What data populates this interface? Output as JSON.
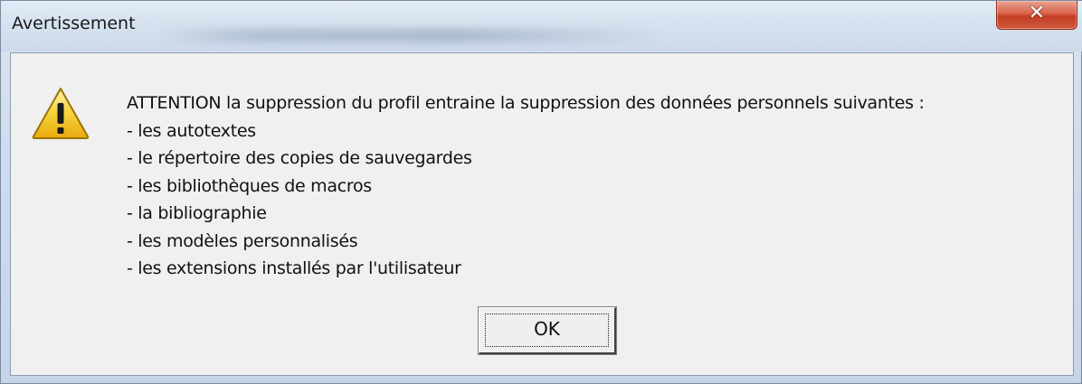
{
  "window": {
    "title": "Avertissement",
    "close_glyph": "✕"
  },
  "icon": {
    "name": "warning-icon",
    "color_fill": "#f5c518",
    "color_border": "#8a6a00"
  },
  "message": {
    "lines": [
      "ATTENTION la suppression du profil entraine la suppression des données personnels suivantes :",
      "- les autotextes",
      "- le répertoire des copies de sauvegardes",
      "- les bibliothèques de macros",
      "- la bibliographie",
      "- les modèles personnalisés",
      "- les extensions installés par l'utilisateur"
    ]
  },
  "buttons": {
    "ok_label": "OK"
  }
}
